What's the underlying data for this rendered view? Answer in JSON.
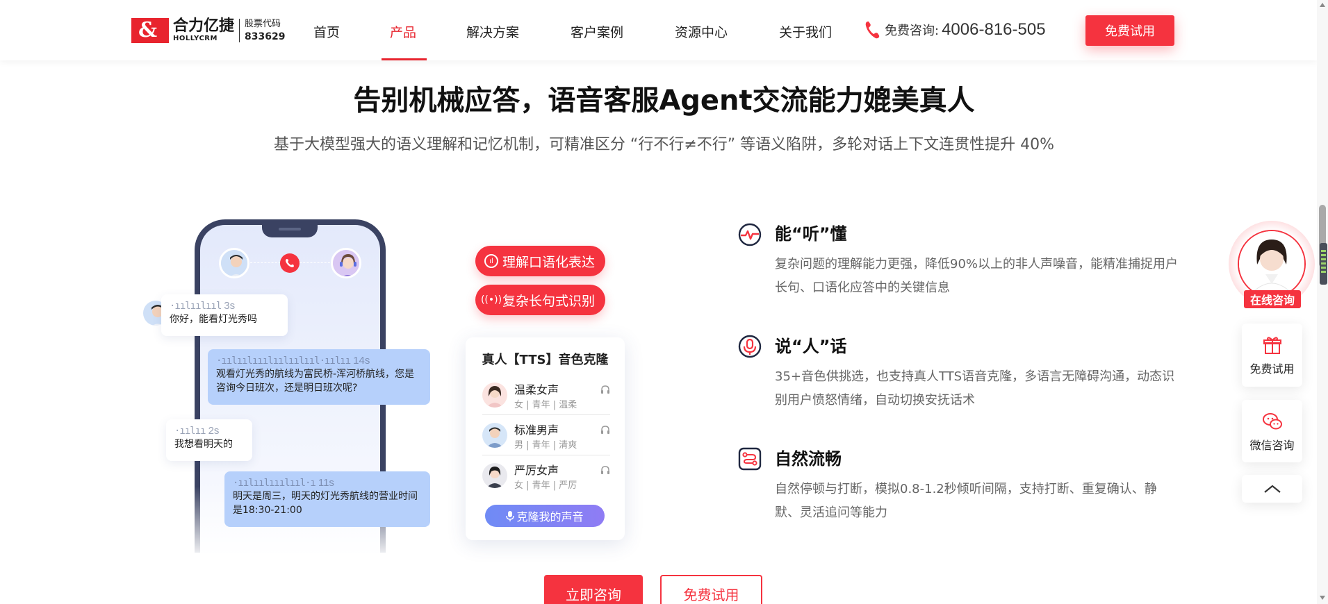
{
  "header": {
    "logo": {
      "brand_cn": "合力亿捷",
      "brand_en": "HOLLYCRM",
      "stock_label": "股票代码",
      "stock_code": "833629"
    },
    "nav": [
      {
        "label": "首页",
        "active": false
      },
      {
        "label": "产品",
        "active": true
      },
      {
        "label": "解决方案",
        "active": false
      },
      {
        "label": "客户案例",
        "active": false
      },
      {
        "label": "资源中心",
        "active": false
      },
      {
        "label": "关于我们",
        "active": false
      }
    ],
    "phone_label": "免费咨询:",
    "phone_number": "4006-816-505",
    "trial_button": "免费试用",
    "accent_color": "#f5333f"
  },
  "hero": {
    "title": "告别机械应答，语音客服Agent交流能力媲美真人",
    "subtitle": "基于大模型强大的语义理解和记忆机制，可精准区分 “行不行≠不行” 等语义陷阱，多轮对话上下文连贯性提升 40%"
  },
  "chat": {
    "messages": [
      {
        "side": "user",
        "duration": "3s",
        "text": "你好，能看灯光秀吗"
      },
      {
        "side": "agent",
        "duration": "14s",
        "text": "观看灯光秀的航线为富民桥-浑河桥航线，您是咨询今日班次，还是明日班次呢?"
      },
      {
        "side": "user",
        "duration": "2s",
        "text": "我想看明天的"
      },
      {
        "side": "agent",
        "duration": "11s",
        "text": "明天是周三，明天的灯光秀航线的营业时间是18:30-21:00"
      }
    ]
  },
  "pills": [
    {
      "label": "理解口语化表达",
      "icon": "waveform-icon"
    },
    {
      "label": "复杂长句式识别",
      "icon": "broadcast-icon"
    }
  ],
  "voice_card": {
    "title": "真人【TTS】音色克隆",
    "voices": [
      {
        "name": "温柔女声",
        "tags": "女 | 青年 | 温柔"
      },
      {
        "name": "标准男声",
        "tags": "男 | 青年 | 清爽"
      },
      {
        "name": "严厉女声",
        "tags": "女 | 青年 | 严厉"
      }
    ],
    "clone_button": "克隆我的声音"
  },
  "features": [
    {
      "icon": "heartbeat-ear-icon",
      "title": "能“听”懂",
      "desc": "复杂问题的理解能力更强，降低90%以上的非人声噪音，能精准捕捉用户长句、口语化应答中的关键信息"
    },
    {
      "icon": "microphone-icon",
      "title": "说“人”话",
      "desc": "35+音色供挑选，也支持真人TTS语音克隆，多语言无障碍沟通，动态识别用户愤怒情绪，自动切换安抚话术"
    },
    {
      "icon": "flow-icon",
      "title": "自然流畅",
      "desc": "自然停顿与打断，模拟0.8-1.2秒倾听间隔，支持打断、重复确认、静默、灵活追问等能力"
    }
  ],
  "cta": {
    "consult": "立即咨询",
    "trial": "免费试用"
  },
  "float_bar": {
    "online": "在线咨询",
    "trial": "免费试用",
    "wechat": "微信咨询"
  }
}
